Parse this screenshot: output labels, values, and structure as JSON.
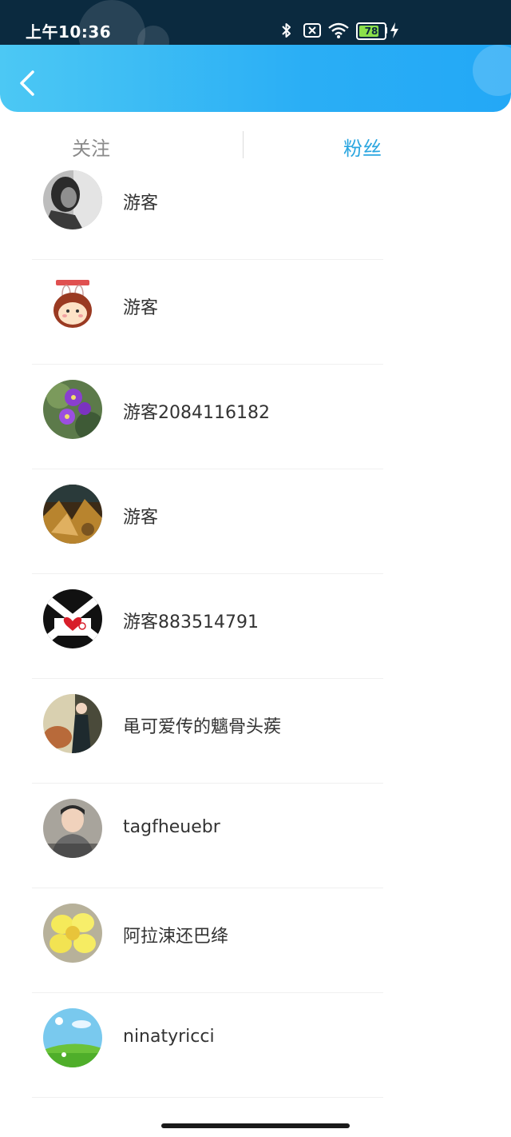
{
  "status_bar": {
    "time": "上午10:36",
    "battery_level": "78"
  },
  "header": {
    "back_icon": "chevron-left-icon"
  },
  "tabs": [
    {
      "label": "关注",
      "active": false
    },
    {
      "label": "粉丝",
      "active": true
    }
  ],
  "colors": {
    "accent": "#2aa6e0",
    "header_start": "#4cc8f4",
    "header_end": "#23a8f6",
    "status_bg": "#0b2a3f"
  },
  "users": [
    {
      "name": "游客",
      "avatar": "avatar-photo-woman"
    },
    {
      "name": "游客",
      "avatar": "avatar-bunny-cartoon"
    },
    {
      "name": "游客2084116182",
      "avatar": "avatar-purple-flowers"
    },
    {
      "name": "游客",
      "avatar": "avatar-golden-art"
    },
    {
      "name": "游客883514791",
      "avatar": "avatar-heart-logo"
    },
    {
      "name": "黾可爱传的魑骨头蒺",
      "avatar": "avatar-photo-woman-qipao"
    },
    {
      "name": "tagfheuebr",
      "avatar": "avatar-photo-man"
    },
    {
      "name": "阿拉涑还巴绛",
      "avatar": "avatar-yellow-flower"
    },
    {
      "name": "ninatyricci",
      "avatar": "avatar-sky-landscape"
    }
  ]
}
